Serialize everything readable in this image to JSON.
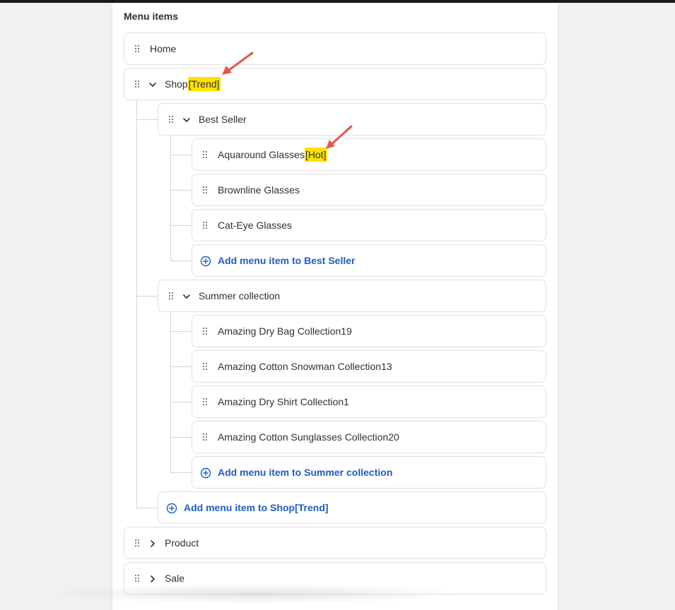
{
  "section": {
    "title": "Menu items"
  },
  "items": {
    "home": {
      "label": "Home"
    },
    "shop": {
      "label": "Shop",
      "badge": "[Trend]"
    },
    "best_seller": {
      "label": "Best Seller"
    },
    "aquaround": {
      "label": "Aquaround Glasses",
      "badge": "[Hot]"
    },
    "brownline": {
      "label": "Brownline Glasses"
    },
    "cateye": {
      "label": "Cat-Eye Glasses"
    },
    "add_best_seller": {
      "label": "Add menu item to Best Seller"
    },
    "summer": {
      "label": "Summer collection"
    },
    "dry_bag": {
      "label": "Amazing Dry Bag Collection19"
    },
    "cotton_snowman": {
      "label": "Amazing Cotton Snowman Collection13"
    },
    "dry_shirt": {
      "label": "Amazing Dry Shirt Collection1"
    },
    "cotton_sunglasses": {
      "label": "Amazing Cotton Sunglasses Collection20"
    },
    "add_summer": {
      "label": "Add menu item to Summer collection"
    },
    "add_shop": {
      "label": "Add menu item to Shop[Trend]"
    },
    "product": {
      "label": "Product"
    },
    "sale": {
      "label": "Sale"
    }
  },
  "colors": {
    "highlight": "#ffe100",
    "link": "#1f5bcc",
    "annotation_arrow": "#e5574b"
  },
  "icons": [
    "drag-handle-icon",
    "chevron-down-icon",
    "chevron-right-icon",
    "plus-circle-icon",
    "annotation-arrow-icon"
  ]
}
